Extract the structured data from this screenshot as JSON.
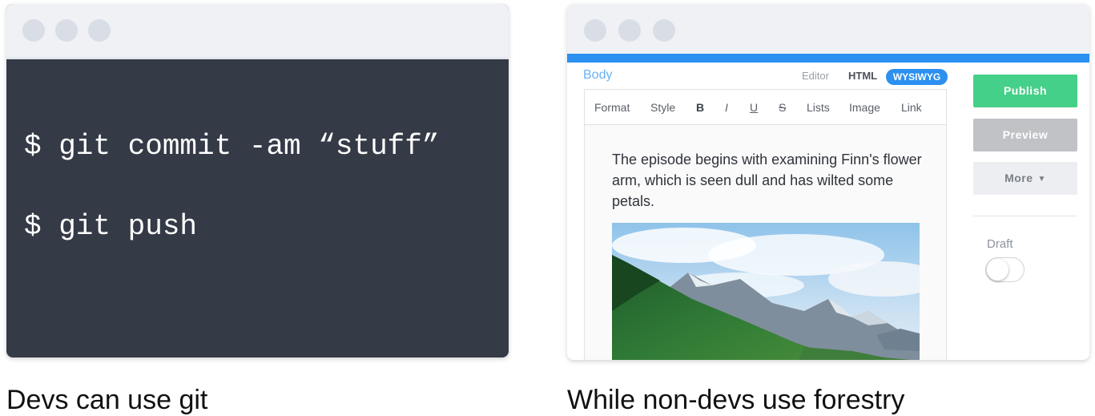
{
  "terminal": {
    "lines": [
      "$ git commit -am “stuff”",
      "$ git push"
    ],
    "caption": "Devs can use git"
  },
  "cms": {
    "body_label": "Body",
    "modes": {
      "editor": "Editor",
      "html": "HTML",
      "wysiwyg": "WYSIWYG"
    },
    "toolbar": {
      "format": "Format",
      "style": "Style",
      "bold": "B",
      "italic": "I",
      "underline": "U",
      "strike": "S",
      "lists": "Lists",
      "image": "Image",
      "link": "Link"
    },
    "content": "The episode begins with examining Finn's flower arm, which is seen dull and has wilted some petals.",
    "buttons": {
      "publish": "Publish",
      "preview": "Preview",
      "more": "More"
    },
    "draft_label": "Draft",
    "draft_enabled": false,
    "caption": "While non-devs use forestry"
  },
  "colors": {
    "terminal_bg": "#343a46",
    "accent": "#2b90f0",
    "publish": "#45d089",
    "preview": "#c0c2c6"
  },
  "icons": {
    "window_controls": "circle-dot",
    "more_caret": "caret-down-icon"
  }
}
